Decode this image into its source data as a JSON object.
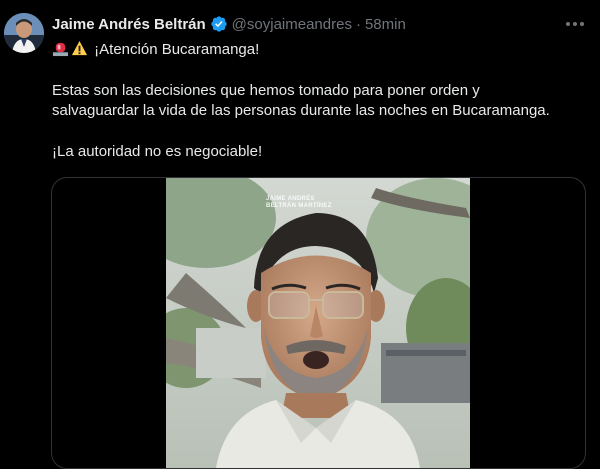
{
  "post": {
    "author_name": "Jaime Andrés Beltrán",
    "handle": "@soyjaimeandres",
    "separator": "·",
    "time_ago": "58min",
    "headline": "¡Atención Bucaramanga!",
    "body_line_1": "Estas son las decisiones que hemos tomado para poner orden y",
    "body_line_2": "salvaguardar la vida de las personas durante las noches en Bucaramanga.",
    "body_line_3": "¡La autoridad no es negociable!",
    "emojis": [
      "police-light-icon",
      "warning-icon"
    ]
  },
  "video": {
    "watermark_line_1": "JAIME ANDRÉS",
    "watermark_line_2": "BELTRÁN MARTÍNEZ"
  },
  "colors": {
    "background": "#000000",
    "text": "#e7e9ea",
    "muted": "#71767b",
    "verified": "#1d9bf0",
    "border": "#2f3336"
  }
}
